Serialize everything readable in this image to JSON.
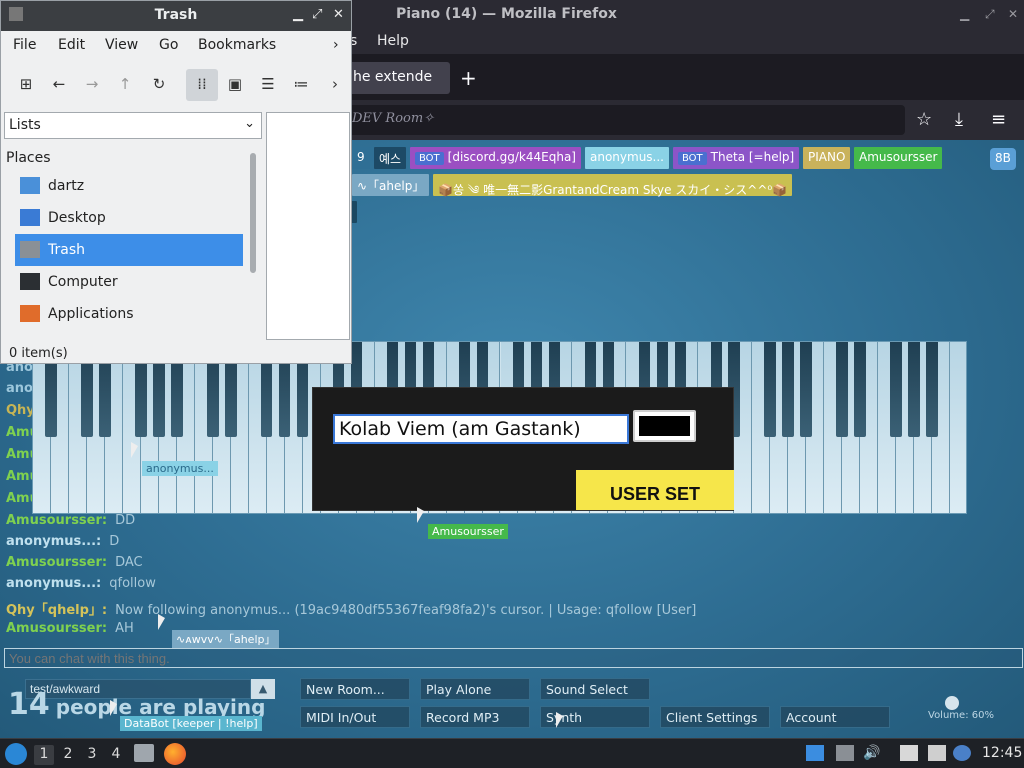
{
  "firefox": {
    "title": "Piano (14) — Mozilla Firefox",
    "menu_help": "Help",
    "menu_partial": "s",
    "tab_label": "he extende",
    "new_tab_icon": "plus-icon",
    "url_text": "DEV Room✧"
  },
  "room_users": [
    {
      "label": "9",
      "color": "#2f6f95"
    },
    {
      "label": "예스",
      "color": "#1d4a66"
    },
    {
      "label": "[discord.gg/k44Eqha]",
      "color": "#9b4fc2",
      "bot": "BOT"
    },
    {
      "label": "anonymus...",
      "color": "#8ad2e6"
    },
    {
      "label": "Theta [=help]",
      "color": "#8c55c8",
      "bot": "BOT"
    },
    {
      "label": "PIANO",
      "color": "#c9b25b"
    },
    {
      "label": "Amusoursser",
      "color": "#45b94a"
    }
  ],
  "room_users_row2": [
    {
      "label": "∿「ahelp」",
      "color": "#7aa8c4"
    },
    {
      "label": "📦쏭 ༄ 唯一無二影GrantandCream Skye スカイ・シス^^⁰📦",
      "color": "#c9c051"
    }
  ],
  "room_users_row3": [
    {
      "label": ")",
      "color": "#1b4862"
    }
  ],
  "room_user_count_badge": "8B",
  "faded_text": "...",
  "chat": [
    {
      "name": "ano",
      "msg": "",
      "color": "#9cc7dc"
    },
    {
      "name": "ano",
      "msg": "",
      "color": "#9cc7dc"
    },
    {
      "name": "Qhy",
      "msg": "",
      "color": "#c7b555"
    },
    {
      "name": "Amu",
      "msg": "",
      "color": "#7fd14f"
    },
    {
      "name": "Amu",
      "msg": "",
      "color": "#7fd14f"
    },
    {
      "name": "Amu",
      "msg": "",
      "color": "#7fd14f"
    },
    {
      "name": "Amu",
      "msg": "",
      "color": "#7fd14f"
    },
    {
      "name": "Amusoursser:",
      "msg": "DD",
      "color": "#7fd14f"
    },
    {
      "name": "anonymus...:",
      "msg": "D",
      "color": "#bfe0ee"
    },
    {
      "name": "Amusoursser:",
      "msg": "DAC",
      "color": "#7fd14f"
    },
    {
      "name": "anonymus...:",
      "msg": "qfollow",
      "color": "#bfe0ee"
    },
    {
      "name": "Qhy「qhelp」:",
      "msg": "Now following anonymus... (19ac9480df55367feaf98fa2)'s cursor. | Usage: qfollow [User]",
      "color": "#d4c35a"
    },
    {
      "name": "Amusoursser:",
      "msg": "AH",
      "color": "#7fd14f"
    }
  ],
  "dialog": {
    "name_value": "Kolab Viem (am Gastank)",
    "color_value": "#000000",
    "button_label": "USER SET"
  },
  "cursor_tags": {
    "anon": "anonymus...",
    "amus": "Amusoursser",
    "qhy": "∿ᴀᴡᴠᴠ∿「ahelp」",
    "databot": "DataBot [keeper | !help]",
    "small": "ahelp",
    "synth_tag": "Qhy"
  },
  "chat_input_placeholder": "You can chat with this thing.",
  "room_input_value": "test/awkward",
  "people_count": "14",
  "people_text": "people are playing",
  "controls": [
    {
      "label": "New Room...",
      "name": "new-room-button"
    },
    {
      "label": "Play Alone",
      "name": "play-alone-button"
    },
    {
      "label": "Sound Select",
      "name": "sound-select-button"
    },
    {
      "label": "MIDI In/Out",
      "name": "midi-button"
    },
    {
      "label": "Record MP3",
      "name": "record-mp3-button"
    },
    {
      "label": "Synth",
      "name": "synth-button"
    },
    {
      "label": "Client Settings",
      "name": "client-settings-button"
    },
    {
      "label": "Account",
      "name": "account-button"
    }
  ],
  "volume_label": "Volume: 60%",
  "volume_level": 0.6,
  "file_manager": {
    "title": "Trash",
    "menu": [
      "File",
      "Edit",
      "View",
      "Go",
      "Bookmarks"
    ],
    "location": "Lists",
    "places_header": "Places",
    "places": [
      {
        "label": "dartz",
        "icon": "home-folder-icon",
        "color": "#4a90d9"
      },
      {
        "label": "Desktop",
        "icon": "desktop-icon",
        "color": "#3a7bd5"
      },
      {
        "label": "Trash",
        "icon": "trash-icon",
        "color": "#8a9096",
        "selected": true
      },
      {
        "label": "Computer",
        "icon": "computer-icon",
        "color": "#2b2f33"
      },
      {
        "label": "Applications",
        "icon": "applications-icon",
        "color": "#e06c2b"
      }
    ],
    "status": "0 item(s)"
  },
  "taskbar": {
    "workspaces": [
      "1",
      "2",
      "3",
      "4"
    ],
    "clock": "12:45"
  }
}
